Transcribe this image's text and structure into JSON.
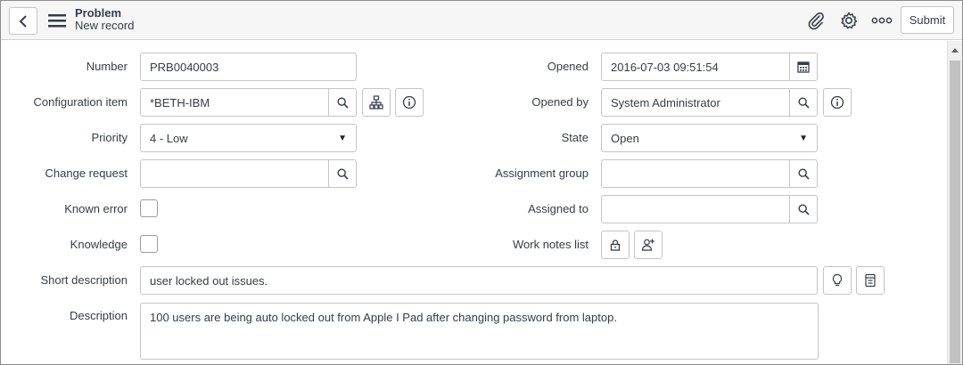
{
  "header": {
    "title": "Problem",
    "subtitle": "New record",
    "submit_label": "Submit"
  },
  "icons": {
    "back": "chevron-left-icon",
    "menu": "hamburger-menu-icon",
    "attach": "paperclip-icon",
    "settings": "gear-icon",
    "more": "more-options-icon",
    "search": "search-icon",
    "info": "info-icon",
    "calendar": "calendar-icon",
    "tree": "dependency-tree-icon",
    "lock": "lock-icon",
    "add_user": "add-user-icon",
    "lightbulb": "lightbulb-icon",
    "template": "template-icon"
  },
  "form": {
    "number": {
      "label": "Number",
      "value": "PRB0040003"
    },
    "configuration_item": {
      "label": "Configuration item",
      "value": "*BETH-IBM"
    },
    "priority": {
      "label": "Priority",
      "value": "4 - Low"
    },
    "change_request": {
      "label": "Change request",
      "value": ""
    },
    "known_error": {
      "label": "Known error",
      "checked": false
    },
    "knowledge": {
      "label": "Knowledge",
      "checked": false
    },
    "opened": {
      "label": "Opened",
      "value": "2016-07-03 09:51:54"
    },
    "opened_by": {
      "label": "Opened by",
      "value": "System Administrator"
    },
    "state": {
      "label": "State",
      "value": "Open"
    },
    "assignment_group": {
      "label": "Assignment group",
      "value": ""
    },
    "assigned_to": {
      "label": "Assigned to",
      "value": ""
    },
    "work_notes_list": {
      "label": "Work notes list"
    },
    "short_description": {
      "label": "Short description",
      "value": "user locked out issues."
    },
    "description": {
      "label": "Description",
      "value": "100 users are being auto locked out from Apple I Pad after changing password from laptop."
    }
  },
  "colors": {
    "header_bg": "#f6f6f6",
    "border": "#c5c5c5",
    "text": "#343d47"
  }
}
